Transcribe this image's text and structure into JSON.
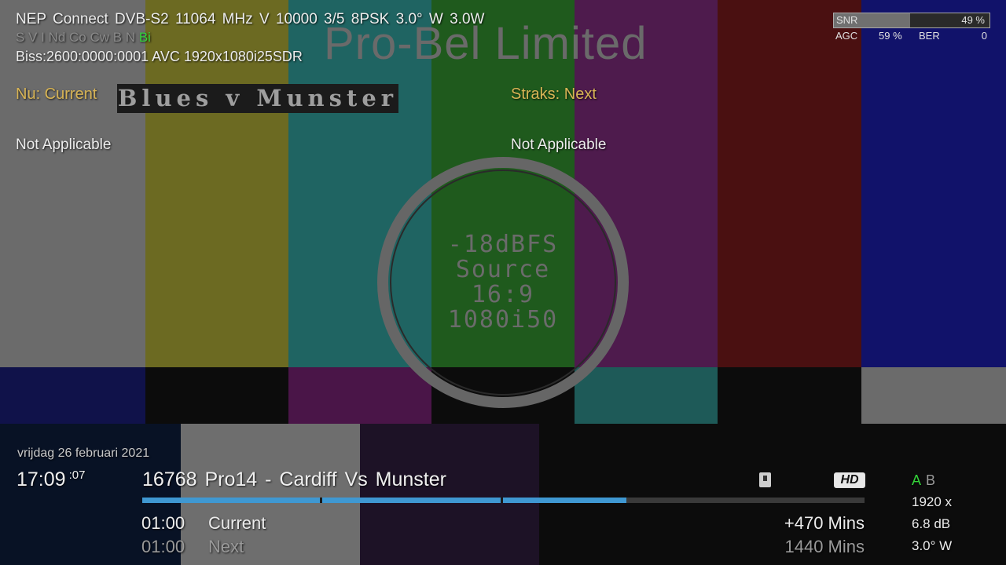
{
  "signal_info": {
    "line1": "NEP Connect  DVB-S2  11064 MHz  V  10000  3/5  8PSK  3.0° W  3.0W",
    "flags_inactive": "S V I Nd Co Cw B N",
    "flags_active": "Bi",
    "line3": "Biss:2600:0000:0001  AVC  1920x1080i25SDR"
  },
  "test_card": {
    "title": "Pro-Bel Limited",
    "circle_lines": [
      "-18dBFS",
      "Source",
      "16:9",
      "1080i50"
    ]
  },
  "meter": {
    "snr_label": "SNR",
    "snr_percent": 49,
    "snr_value": "49 %",
    "agc_label": "AGC",
    "agc_value": "59 %",
    "ber_label": "BER",
    "ber_value": "0"
  },
  "epg": {
    "now_label": "Nu: Current",
    "now_title": "Blues v Munster",
    "now_desc": "Not Applicable",
    "next_label": "Straks: Next",
    "next_desc": "Not Applicable"
  },
  "infobar": {
    "date": "vrijdag 26 februari 2021",
    "time": "17:09",
    "seconds": ":07",
    "channel_number": "16768",
    "channel_name": "Pro14 - Cardiff Vs Munster",
    "hd_badge": "HD",
    "progress_fraction": 0.67,
    "current": {
      "time": "01:00",
      "title": "Current",
      "duration": "+470 Mins"
    },
    "next": {
      "time": "01:00",
      "title": "Next",
      "duration": "1440 Mins"
    },
    "tuner_active": "A",
    "tuner_inactive": "B",
    "resolution": "1920 x",
    "snr_db": "6.8 dB",
    "position": "3.0° W"
  },
  "colors": {
    "flag_active": "#34d33a",
    "epg_label": "#d8b455",
    "progress": "#3f98d2"
  }
}
